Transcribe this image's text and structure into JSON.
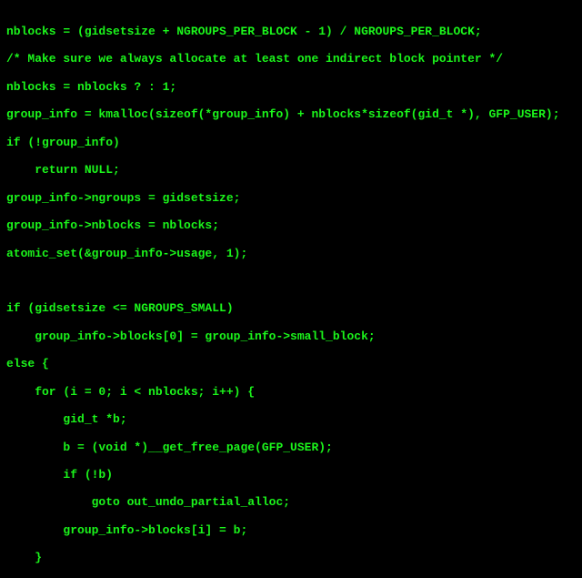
{
  "code": {
    "color": "#1bf51b",
    "background": "#000000",
    "lines": [
      "nblocks = (gidsetsize + NGROUPS_PER_BLOCK - 1) / NGROUPS_PER_BLOCK;",
      "/* Make sure we always allocate at least one indirect block pointer */",
      "nblocks = nblocks ? : 1;",
      "group_info = kmalloc(sizeof(*group_info) + nblocks*sizeof(gid_t *), GFP_USER);",
      "if (!group_info)",
      "    return NULL;",
      "group_info->ngroups = gidsetsize;",
      "group_info->nblocks = nblocks;",
      "atomic_set(&group_info->usage, 1);",
      "",
      "if (gidsetsize <= NGROUPS_SMALL)",
      "    group_info->blocks[0] = group_info->small_block;",
      "else {",
      "    for (i = 0; i < nblocks; i++) {",
      "        gid_t *b;",
      "        b = (void *)__get_free_page(GFP_USER);",
      "        if (!b)",
      "            goto out_undo_partial_alloc;",
      "        group_info->blocks[i] = b;",
      "    }"
    ]
  }
}
